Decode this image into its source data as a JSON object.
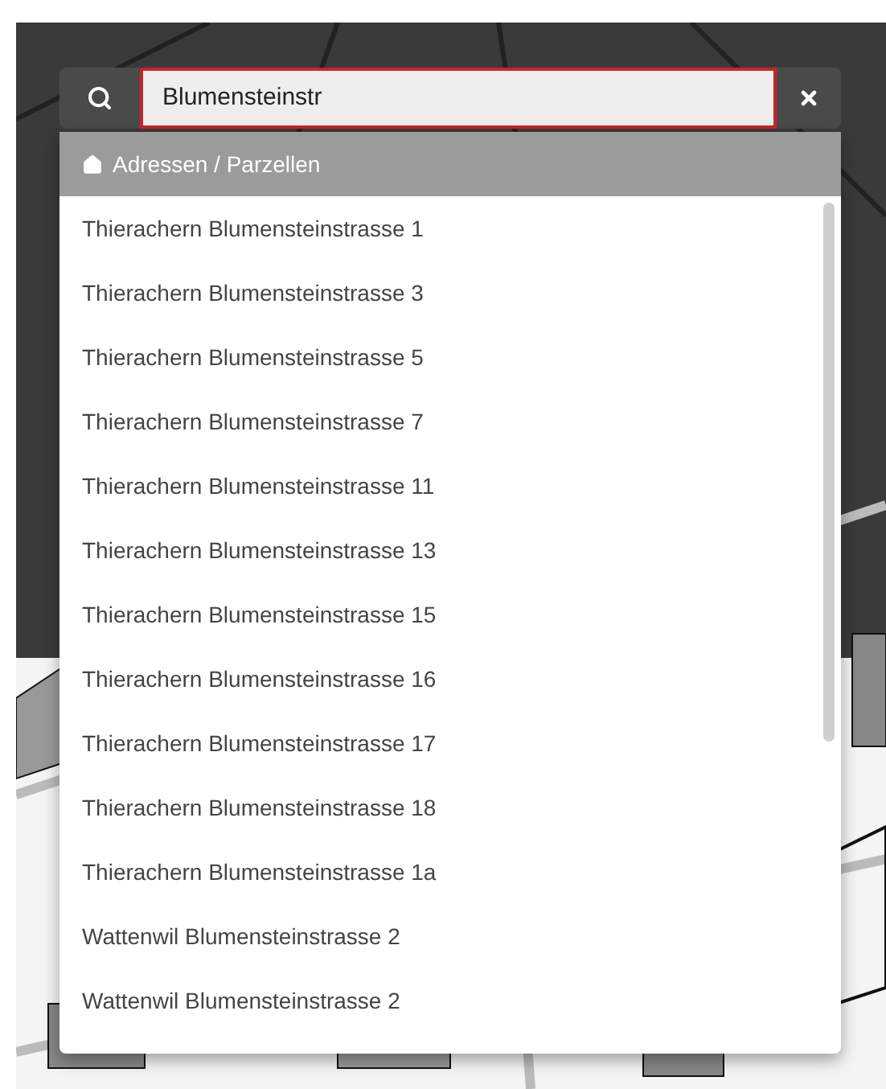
{
  "search": {
    "value": "Blumensteinstr"
  },
  "results": {
    "category": "Adressen / Parzellen",
    "items": [
      "Thierachern Blumensteinstrasse 1",
      "Thierachern Blumensteinstrasse 3",
      "Thierachern Blumensteinstrasse 5",
      "Thierachern Blumensteinstrasse 7",
      "Thierachern Blumensteinstrasse 11",
      "Thierachern Blumensteinstrasse 13",
      "Thierachern Blumensteinstrasse 15",
      "Thierachern Blumensteinstrasse 16",
      "Thierachern Blumensteinstrasse 17",
      "Thierachern Blumensteinstrasse 18",
      "Thierachern Blumensteinstrasse 1a",
      "Wattenwil Blumensteinstrasse 2",
      "Wattenwil Blumensteinstrasse 2"
    ]
  }
}
